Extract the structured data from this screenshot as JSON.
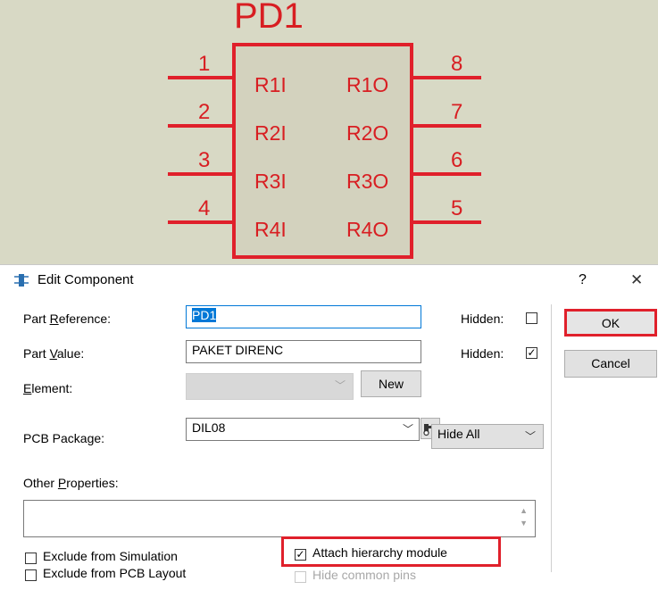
{
  "schematic": {
    "component_ref": "PD1",
    "left_pins": [
      {
        "number": "1",
        "name": "R1I"
      },
      {
        "number": "2",
        "name": "R2I"
      },
      {
        "number": "3",
        "name": "R3I"
      },
      {
        "number": "4",
        "name": "R4I"
      }
    ],
    "right_pins": [
      {
        "number": "8",
        "name": "R1O"
      },
      {
        "number": "7",
        "name": "R2O"
      },
      {
        "number": "6",
        "name": "R3O"
      },
      {
        "number": "5",
        "name": "R4O"
      }
    ]
  },
  "dialog": {
    "title": "Edit Component",
    "help_label": "?",
    "close_label": "✕",
    "part_reference": {
      "label_pre": "Part ",
      "label_u": "R",
      "label_post": "eference:",
      "value": "PD1",
      "hidden_label": "Hidden:",
      "hidden_checked": false
    },
    "part_value": {
      "label_pre": "Part ",
      "label_u": "V",
      "label_post": "alue:",
      "value": "PAKET DIRENC",
      "hidden_label": "Hidden:",
      "hidden_checked": true
    },
    "element": {
      "label_u": "E",
      "label_post": "lement:",
      "value": "",
      "new_button": "New"
    },
    "pcb_package": {
      "label": "PCB Package:",
      "value": "DIL08",
      "hide_value": "Hide All"
    },
    "other_properties": {
      "label_pre": "Other ",
      "label_u": "P",
      "label_post": "roperties:",
      "value": ""
    },
    "checkboxes": {
      "exclude_simulation": {
        "label": "Exclude from Simulation",
        "checked": false
      },
      "exclude_pcb": {
        "label": "Exclude from PCB Layout",
        "checked": false
      },
      "attach_hierarchy": {
        "label": "Attach hierarchy module",
        "checked": true
      },
      "hide_common_pins": {
        "label": "Hide common pins",
        "checked": false
      }
    },
    "ok_label": "OK",
    "cancel_label": "Cancel"
  },
  "colors": {
    "accent_red": "#e0202b",
    "schematic_bg": "#d8d9c5",
    "chip_fill": "#d3d2be"
  }
}
